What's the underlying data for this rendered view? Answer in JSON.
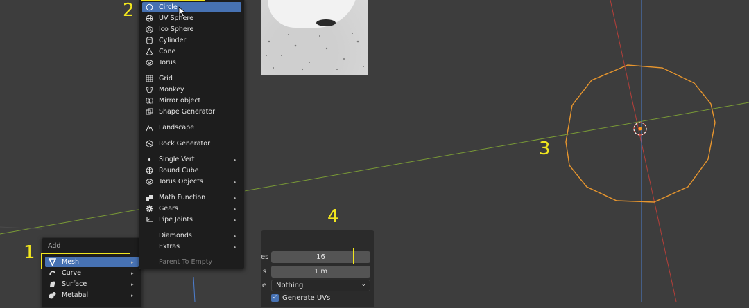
{
  "add_menu": {
    "title": "Add",
    "items": [
      {
        "label": "Mesh",
        "icon": "mesh-triangle-icon",
        "selected": true,
        "submenu": true
      },
      {
        "label": "Curve",
        "icon": "curve-icon",
        "submenu": true
      },
      {
        "label": "Surface",
        "icon": "surface-icon",
        "submenu": true
      },
      {
        "label": "Metaball",
        "icon": "metaball-icon",
        "submenu": true
      }
    ]
  },
  "mesh_menu": {
    "items": [
      {
        "label": "Circle",
        "icon": "circle-icon",
        "selected": true
      },
      {
        "label": "UV Sphere",
        "icon": "uv-sphere-icon"
      },
      {
        "label": "Ico Sphere",
        "icon": "ico-sphere-icon"
      },
      {
        "label": "Cylinder",
        "icon": "cylinder-icon"
      },
      {
        "label": "Cone",
        "icon": "cone-icon"
      },
      {
        "label": "Torus",
        "icon": "torus-icon"
      },
      {
        "label": "Grid",
        "icon": "grid-icon"
      },
      {
        "label": "Monkey",
        "icon": "monkey-icon"
      },
      {
        "label": "Mirror object",
        "icon": "mirror-object-icon"
      },
      {
        "label": "Shape Generator",
        "icon": "shape-generator-icon"
      },
      {
        "label": "Landscape",
        "icon": "landscape-icon"
      },
      {
        "label": "Rock Generator",
        "icon": "rock-generator-icon"
      },
      {
        "label": "Single Vert",
        "icon": "dot-icon",
        "submenu": true
      },
      {
        "label": "Round Cube",
        "icon": "round-cube-icon"
      },
      {
        "label": "Torus Objects",
        "icon": "torus-objects-icon",
        "submenu": true
      },
      {
        "label": "Math Function",
        "icon": "math-function-icon",
        "submenu": true
      },
      {
        "label": "Gears",
        "icon": "gear-icon",
        "submenu": true
      },
      {
        "label": "Pipe Joints",
        "icon": "pipe-joints-icon",
        "submenu": true
      },
      {
        "label": "Diamonds",
        "icon": "",
        "submenu": true
      },
      {
        "label": "Extras",
        "icon": "",
        "submenu": true
      },
      {
        "label": "Parent To Empty",
        "icon": "",
        "disabled": true
      }
    ]
  },
  "operator_panel": {
    "vertices_label_tail": "es",
    "vertices_value": "16",
    "radius_label_tail": "s",
    "radius_value": "1 m",
    "fill_label_tail": "e",
    "fill_type_value": "Nothing",
    "generate_uvs_label": "Generate UVs",
    "generate_uvs_checked": true
  },
  "annotations": {
    "n1": "1",
    "n2": "2",
    "n3": "3",
    "n4": "4"
  },
  "colors": {
    "viewport_bg": "#3d3d3d",
    "menu_bg": "#1d1d1d",
    "selected": "#4772b3",
    "highlight": "#f1e61e",
    "circle_outline": "#e8962e",
    "x_axis": "#c8403c",
    "y_axis": "#7a9b36",
    "z_axis": "#4d7fd0"
  }
}
